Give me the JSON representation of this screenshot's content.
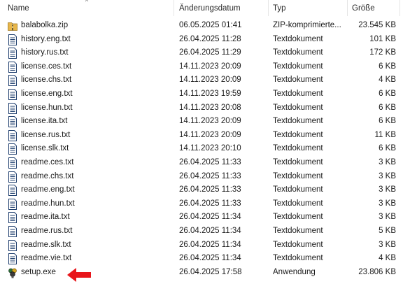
{
  "columns": {
    "name": "Name",
    "date": "Änderungsdatum",
    "type": "Typ",
    "size": "Größe"
  },
  "sort_indicator": "^",
  "files": [
    {
      "name": "balabolka.zip",
      "date": "06.05.2025 01:41",
      "type": "ZIP-komprimierte...",
      "size": "23.545 KB",
      "icon": "zip-folder-icon"
    },
    {
      "name": "history.eng.txt",
      "date": "26.04.2025 11:28",
      "type": "Textdokument",
      "size": "101 KB",
      "icon": "text-file-icon"
    },
    {
      "name": "history.rus.txt",
      "date": "26.04.2025 11:29",
      "type": "Textdokument",
      "size": "172 KB",
      "icon": "text-file-icon"
    },
    {
      "name": "license.ces.txt",
      "date": "14.11.2023 20:09",
      "type": "Textdokument",
      "size": "6 KB",
      "icon": "text-file-icon"
    },
    {
      "name": "license.chs.txt",
      "date": "14.11.2023 20:09",
      "type": "Textdokument",
      "size": "4 KB",
      "icon": "text-file-icon"
    },
    {
      "name": "license.eng.txt",
      "date": "14.11.2023 19:59",
      "type": "Textdokument",
      "size": "6 KB",
      "icon": "text-file-icon"
    },
    {
      "name": "license.hun.txt",
      "date": "14.11.2023 20:08",
      "type": "Textdokument",
      "size": "6 KB",
      "icon": "text-file-icon"
    },
    {
      "name": "license.ita.txt",
      "date": "14.11.2023 20:09",
      "type": "Textdokument",
      "size": "6 KB",
      "icon": "text-file-icon"
    },
    {
      "name": "license.rus.txt",
      "date": "14.11.2023 20:09",
      "type": "Textdokument",
      "size": "11 KB",
      "icon": "text-file-icon"
    },
    {
      "name": "license.slk.txt",
      "date": "14.11.2023 20:10",
      "type": "Textdokument",
      "size": "6 KB",
      "icon": "text-file-icon"
    },
    {
      "name": "readme.ces.txt",
      "date": "26.04.2025 11:33",
      "type": "Textdokument",
      "size": "3 KB",
      "icon": "text-file-icon"
    },
    {
      "name": "readme.chs.txt",
      "date": "26.04.2025 11:33",
      "type": "Textdokument",
      "size": "3 KB",
      "icon": "text-file-icon"
    },
    {
      "name": "readme.eng.txt",
      "date": "26.04.2025 11:33",
      "type": "Textdokument",
      "size": "3 KB",
      "icon": "text-file-icon"
    },
    {
      "name": "readme.hun.txt",
      "date": "26.04.2025 11:33",
      "type": "Textdokument",
      "size": "3 KB",
      "icon": "text-file-icon"
    },
    {
      "name": "readme.ita.txt",
      "date": "26.04.2025 11:34",
      "type": "Textdokument",
      "size": "3 KB",
      "icon": "text-file-icon"
    },
    {
      "name": "readme.rus.txt",
      "date": "26.04.2025 11:34",
      "type": "Textdokument",
      "size": "5 KB",
      "icon": "text-file-icon"
    },
    {
      "name": "readme.slk.txt",
      "date": "26.04.2025 11:34",
      "type": "Textdokument",
      "size": "3 KB",
      "icon": "text-file-icon"
    },
    {
      "name": "readme.vie.txt",
      "date": "26.04.2025 11:34",
      "type": "Textdokument",
      "size": "4 KB",
      "icon": "text-file-icon"
    },
    {
      "name": "setup.exe",
      "date": "26.04.2025 17:58",
      "type": "Anwendung",
      "size": "23.806 KB",
      "icon": "setup-exe-icon"
    }
  ],
  "annotation": {
    "icon": "red-arrow-icon",
    "color": "#e8161b"
  },
  "colors": {
    "zip_folder": "#e8b64a",
    "zip_stripe": "#6b5a2e",
    "text_file_line": "#1f3f6e",
    "text_file_fill": "#ffffff"
  }
}
